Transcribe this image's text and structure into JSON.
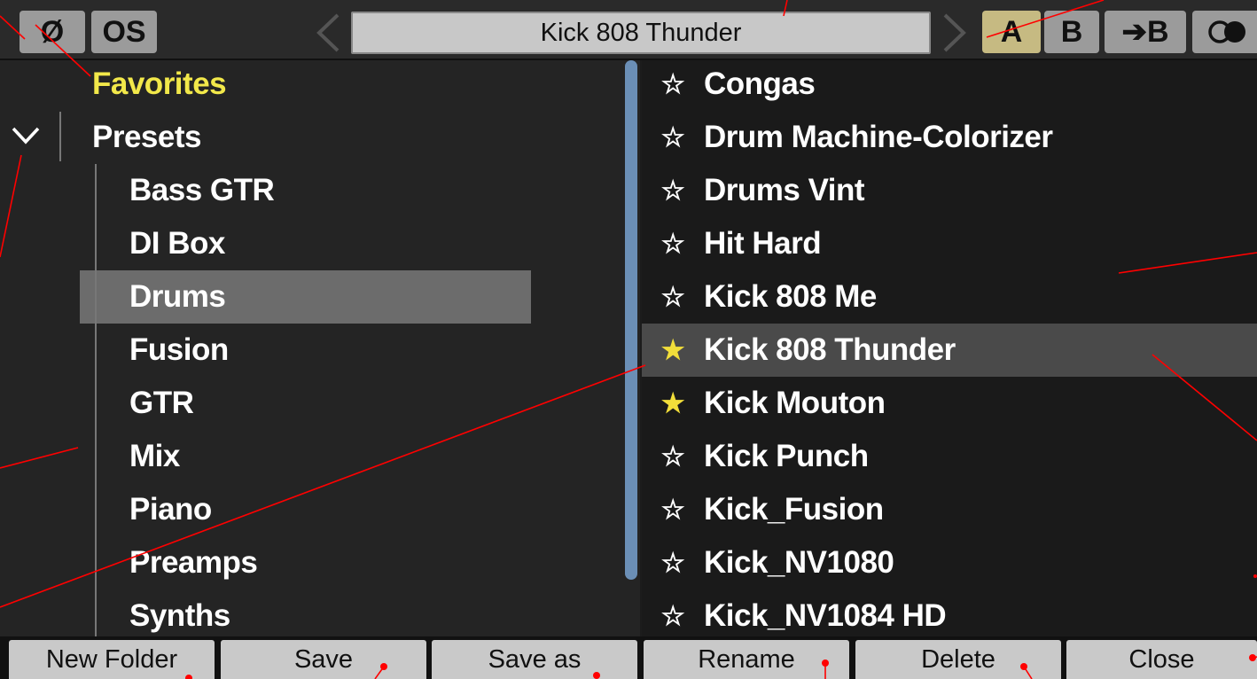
{
  "topbar": {
    "phase_label": "Ø",
    "os_label": "OS",
    "preset_name": "Kick 808 Thunder",
    "a_label": "A",
    "b_label": "B",
    "copy_label": "➔B",
    "compare_icon": "toggle-circles-icon"
  },
  "tree": {
    "favorites": "Favorites",
    "presets": "Presets",
    "folders": [
      "Bass GTR",
      "DI Box",
      "Drums",
      "Fusion",
      "GTR",
      "Mix",
      "Piano",
      "Preamps",
      "Synths"
    ],
    "selected": "Drums"
  },
  "presets": [
    {
      "name": "Congas",
      "fav": false
    },
    {
      "name": "Drum Machine-Colorizer",
      "fav": false
    },
    {
      "name": "Drums Vint",
      "fav": false
    },
    {
      "name": "Hit Hard",
      "fav": false
    },
    {
      "name": "Kick 808 Me",
      "fav": false
    },
    {
      "name": "Kick 808 Thunder",
      "fav": true,
      "selected": true
    },
    {
      "name": "Kick Mouton",
      "fav": true
    },
    {
      "name": "Kick Punch",
      "fav": false
    },
    {
      "name": "Kick_Fusion",
      "fav": false
    },
    {
      "name": "Kick_NV1080",
      "fav": false
    },
    {
      "name": "Kick_NV1084 HD",
      "fav": false
    }
  ],
  "star_empty": "☆",
  "star_full": "★",
  "buttons": {
    "new_folder": "New Folder",
    "save": "Save",
    "save_as": "Save as",
    "rename": "Rename",
    "delete": "Delete",
    "close": "Close"
  },
  "colors": {
    "favorites": "#f2e84a",
    "star_on": "#f2de3a",
    "ab_active": "#c6ba82",
    "scrollbar": "#6b8fb6",
    "annotation": "#ff0000"
  }
}
